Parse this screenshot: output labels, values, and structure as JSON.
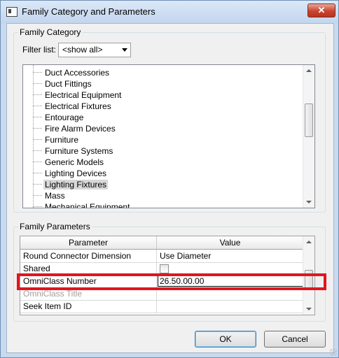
{
  "window": {
    "title": "Family Category and Parameters",
    "close_glyph": "✕"
  },
  "family_category": {
    "group_label": "Family Category",
    "filter_label": "Filter list:",
    "filter_value": "<show all>",
    "items": [
      {
        "label": "Duct Accessories"
      },
      {
        "label": "Duct Fittings"
      },
      {
        "label": "Electrical Equipment"
      },
      {
        "label": "Electrical Fixtures"
      },
      {
        "label": "Entourage"
      },
      {
        "label": "Fire Alarm Devices"
      },
      {
        "label": "Furniture"
      },
      {
        "label": "Furniture Systems"
      },
      {
        "label": "Generic Models"
      },
      {
        "label": "Lighting Devices"
      },
      {
        "label": "Lighting Fixtures",
        "selected": true
      },
      {
        "label": "Mass"
      },
      {
        "label": "Mechanical Equipment"
      }
    ]
  },
  "family_parameters": {
    "group_label": "Family Parameters",
    "columns": [
      "Parameter",
      "Value"
    ],
    "rows": [
      {
        "parameter": "Round Connector Dimension",
        "value": "Use Diameter"
      },
      {
        "parameter": "Shared",
        "value": "",
        "type": "checkbox",
        "checked": false
      },
      {
        "parameter": "OmniClass Number",
        "value": "26.50.00.00",
        "editing": true
      },
      {
        "parameter": "OmniClass Title",
        "value": "",
        "disabled": true
      },
      {
        "parameter": "Seek Item ID",
        "value": ""
      }
    ]
  },
  "buttons": {
    "ok": "OK",
    "cancel": "Cancel"
  },
  "colors": {
    "highlight": "#e0161e",
    "close_button": "#c9432d"
  }
}
